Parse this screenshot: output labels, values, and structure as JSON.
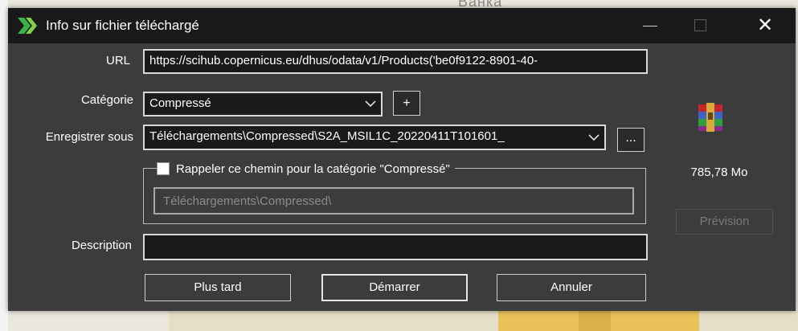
{
  "background": {
    "map_text": "Ванка"
  },
  "dialog": {
    "title": "Info sur fichier téléchargé",
    "window_controls": {
      "minimize": "—",
      "maximize": "☐",
      "close": "✕"
    },
    "url": {
      "label": "URL",
      "value": "https://scihub.copernicus.eu/dhus/odata/v1/Products('be0f9122-8901-40-"
    },
    "category": {
      "label": "Catégorie",
      "value": "Compressé",
      "add_label": "+"
    },
    "save_as": {
      "label": "Enregistrer sous",
      "value": "Téléchargements\\Compressed\\S2A_MSIL1C_20220411T101601_",
      "browse_label": "..."
    },
    "remember_path": {
      "label": "Rappeler ce chemin pour la catégorie \"Compressé\"",
      "checked": false,
      "path_value": "Téléchargements\\Compressed\\"
    },
    "description": {
      "label": "Description",
      "value": ""
    },
    "file_size": "785,78 Mo",
    "preview_label": "Prévision",
    "buttons": {
      "later": "Plus tard",
      "start": "Démarrer",
      "cancel": "Annuler"
    },
    "colors": {
      "titlebar": "#191919",
      "body": "#3c3c3c",
      "app_icon_green": "#39b54a"
    }
  }
}
